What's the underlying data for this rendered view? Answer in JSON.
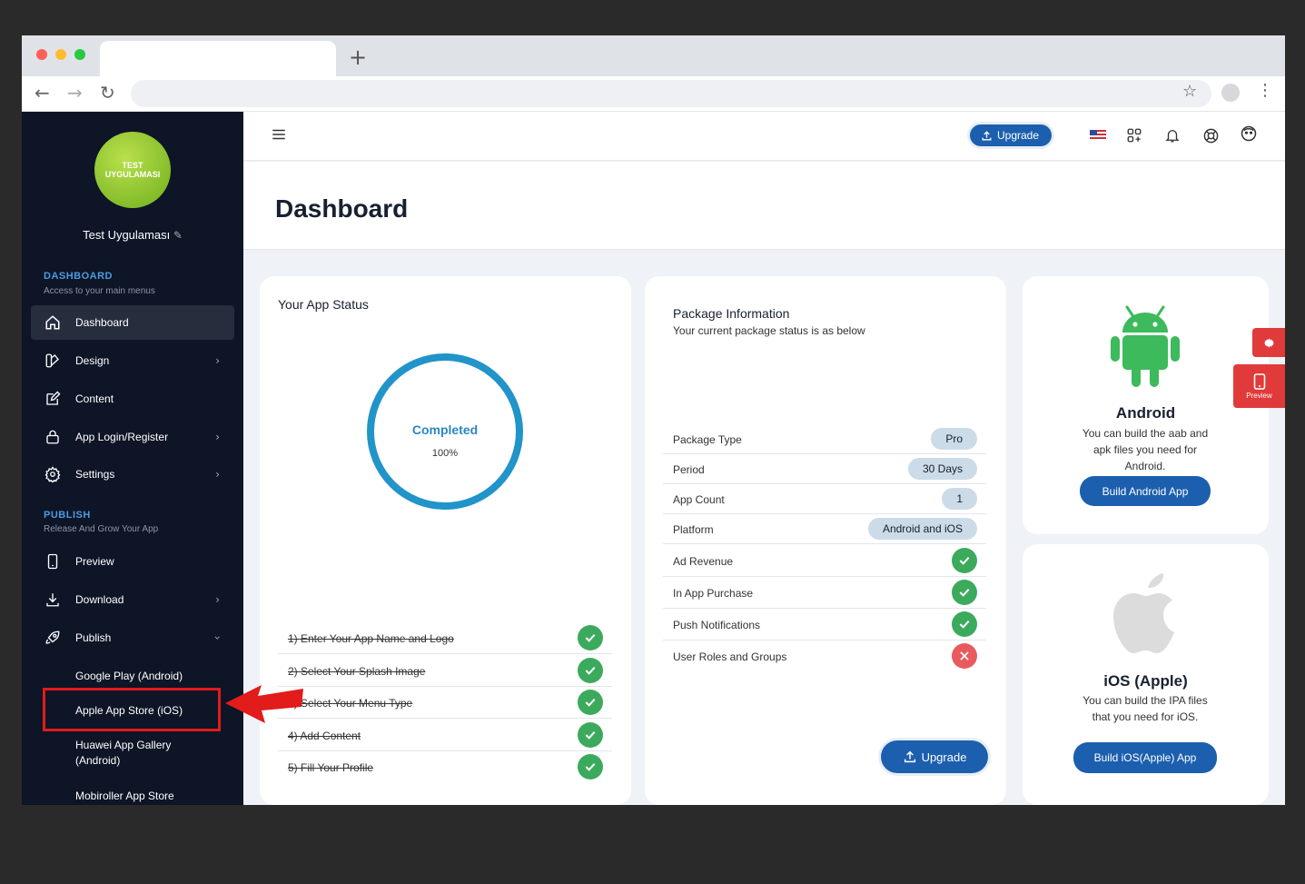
{
  "browser": {
    "new_tab": "+"
  },
  "sidebar": {
    "app_name": "Test Uygulaması",
    "logo": {
      "line1": "TEST",
      "line2": "UYGULAMASI"
    },
    "dashboard_section": {
      "title": "DASHBOARD",
      "subtitle": "Access to your main menus"
    },
    "items": [
      {
        "label": "Dashboard",
        "icon": "home-icon",
        "active": true
      },
      {
        "label": "Design",
        "icon": "design-icon"
      },
      {
        "label": "Content",
        "icon": "edit-icon"
      },
      {
        "label": "App Login/Register",
        "icon": "lock-icon"
      },
      {
        "label": "Settings",
        "icon": "gear-icon"
      }
    ],
    "publish_section": {
      "title": "PUBLISH",
      "subtitle": "Release And Grow Your App"
    },
    "publish_items": [
      {
        "label": "Preview",
        "icon": "phone-icon"
      },
      {
        "label": "Download",
        "icon": "download-icon"
      },
      {
        "label": "Publish",
        "icon": "rocket-icon"
      }
    ],
    "sub_items": [
      "Google Play (Android)",
      "Apple App Store (iOS)",
      "Huawei App Gallery (Android)",
      "Mobiroller App Store"
    ]
  },
  "topbar": {
    "upgrade_label": "Upgrade"
  },
  "page": {
    "title": "Dashboard"
  },
  "app_status": {
    "title": "Your App Status",
    "status": "Completed",
    "percent": "100%",
    "steps": [
      "1) Enter Your App Name and Logo",
      "2) Select Your Splash Image",
      "3) Select Your Menu Type",
      "4) Add Content",
      "5) Fill Your Profile"
    ]
  },
  "package": {
    "title": "Package Information",
    "subtitle": "Your current package status is as below",
    "rows": [
      {
        "key": "Package Type",
        "value": "Pro"
      },
      {
        "key": "Period",
        "value": "30 Days"
      },
      {
        "key": "App Count",
        "value": "1"
      },
      {
        "key": "Platform",
        "value": "Android and iOS"
      }
    ],
    "features": [
      {
        "key": "Ad Revenue",
        "enabled": true
      },
      {
        "key": "In App Purchase",
        "enabled": true
      },
      {
        "key": "Push Notifications",
        "enabled": true
      },
      {
        "key": "User Roles and Groups",
        "enabled": false
      }
    ],
    "upgrade_label": "Upgrade"
  },
  "android": {
    "title": "Android",
    "description": "You can build the aab and apk files you need for Android.",
    "button": "Build Android App"
  },
  "ios": {
    "title": "iOS (Apple)",
    "description": "You can build the IPA files that you need for iOS.",
    "button": "Build iOS(Apple) App"
  },
  "floating": {
    "preview_label": "Preview"
  },
  "colors": {
    "sidebar_bg": "#0d1526",
    "accent_blue": "#1c5fae",
    "success": "#3caa5c",
    "danger": "#e85a5e",
    "annotation_red": "#e21b1b"
  }
}
